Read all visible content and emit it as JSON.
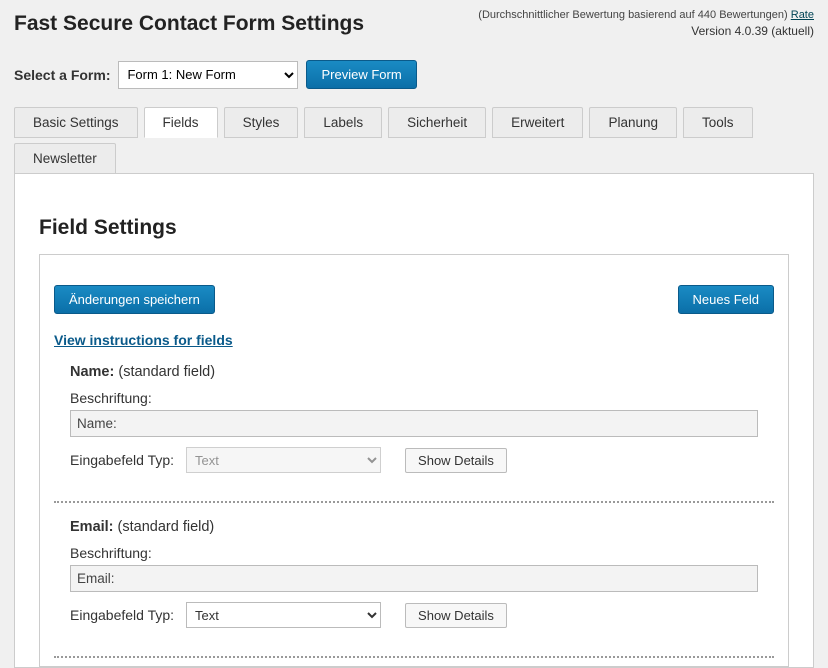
{
  "header": {
    "title": "Fast Secure Contact Form Settings",
    "rating_text": "(Durchschnittlicher Bewertung basierend auf 440 Bewertungen)",
    "rate_link": "Rate",
    "version": "Version 4.0.39 (aktuell)"
  },
  "formSelector": {
    "label": "Select a Form:",
    "selected": "Form 1: New Form",
    "preview_button": "Preview Form"
  },
  "tabs": {
    "row1": [
      "Basic Settings",
      "Fields",
      "Styles",
      "Labels",
      "Sicherheit",
      "Erweitert",
      "Planung",
      "Tools"
    ],
    "row2": [
      "Newsletter"
    ],
    "active": "Fields"
  },
  "panel": {
    "section_title": "Field Settings",
    "save_button": "Änderungen speichern",
    "new_field_button": "Neues Feld",
    "instructions_link": "View instructions for fields"
  },
  "fields": [
    {
      "name": "Name:",
      "suffix": "(standard field)",
      "beschriftung_label": "Beschriftung:",
      "beschriftung_value": "Name:",
      "typ_label": "Eingabefeld Typ:",
      "typ_value": "Text",
      "typ_disabled": true,
      "show_details": "Show Details"
    },
    {
      "name": "Email:",
      "suffix": "(standard field)",
      "beschriftung_label": "Beschriftung:",
      "beschriftung_value": "Email:",
      "typ_label": "Eingabefeld Typ:",
      "typ_value": "Text",
      "typ_disabled": false,
      "show_details": "Show Details"
    }
  ]
}
